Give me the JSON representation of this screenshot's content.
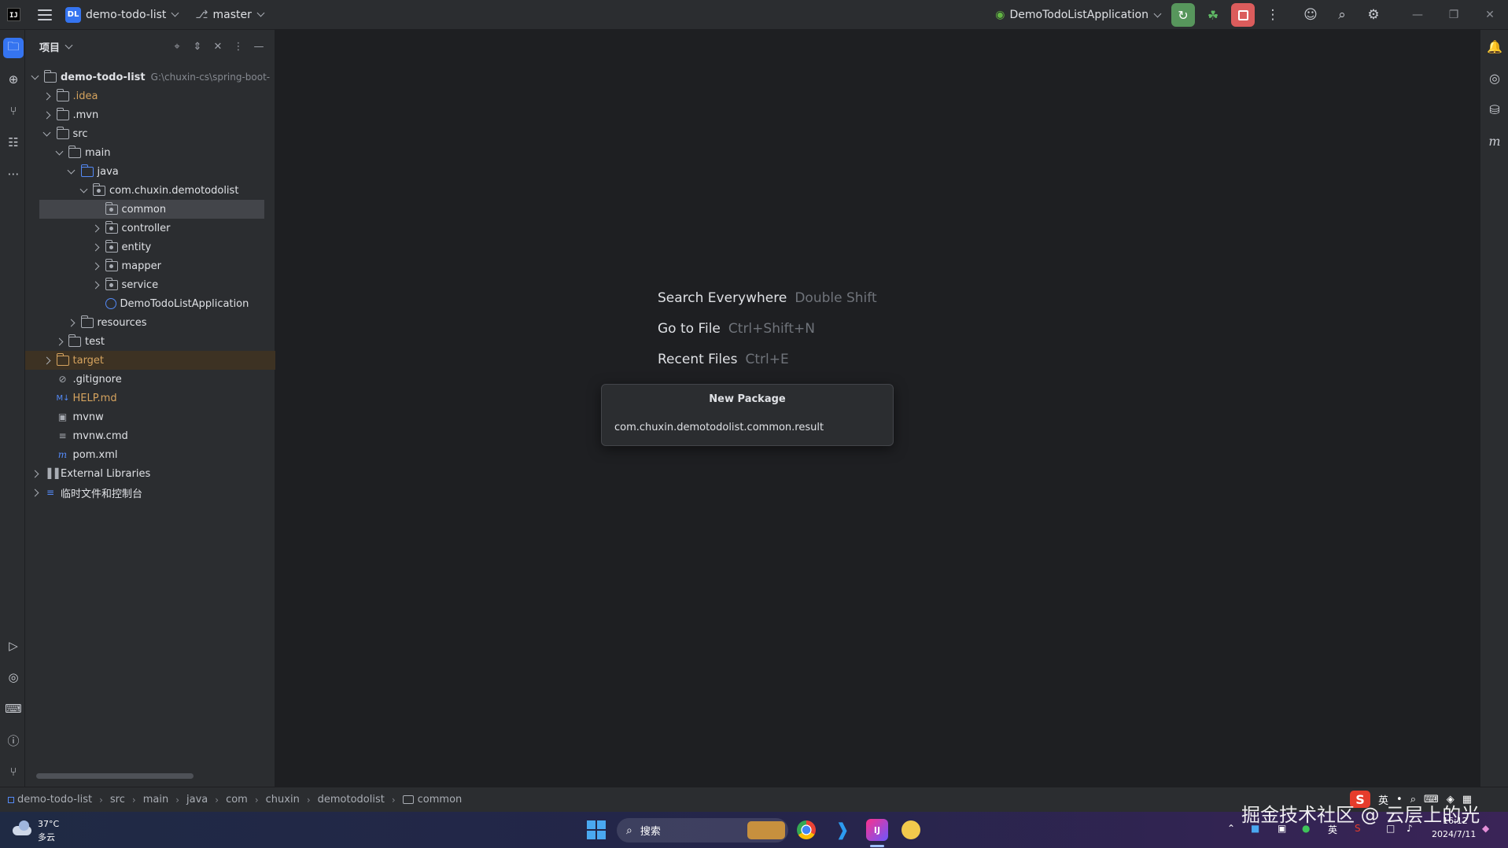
{
  "titlebar": {
    "app_logo": "IJ",
    "project_badge": "DL",
    "project_name": "demo-todo-list",
    "branch_name": "master",
    "run_config": "DemoTodoListApplication",
    "icons": [
      "hamburger-icon",
      "branch-icon",
      "rerun-icon",
      "debug-icon",
      "stop-icon",
      "more-icon",
      "add-user-icon",
      "search-icon",
      "settings-icon"
    ]
  },
  "project_panel": {
    "title": "项目",
    "tree": [
      {
        "label": "demo-todo-list",
        "path": "G:\\chuxin-cs\\spring-boot-",
        "depth": 0,
        "arrow": "d",
        "icon": "module",
        "bold": true
      },
      {
        "label": ".idea",
        "depth": 1,
        "arrow": "r",
        "icon": "folder",
        "color": "orange"
      },
      {
        "label": ".mvn",
        "depth": 1,
        "arrow": "r",
        "icon": "folder"
      },
      {
        "label": "src",
        "depth": 1,
        "arrow": "d",
        "icon": "folder"
      },
      {
        "label": "main",
        "depth": 2,
        "arrow": "d",
        "icon": "folder"
      },
      {
        "label": "java",
        "depth": 3,
        "arrow": "d",
        "icon": "folder-blue"
      },
      {
        "label": "com.chuxin.demotodolist",
        "depth": 4,
        "arrow": "d",
        "icon": "package"
      },
      {
        "label": "common",
        "depth": 5,
        "arrow": "none",
        "icon": "package",
        "selected": true
      },
      {
        "label": "controller",
        "depth": 5,
        "arrow": "r",
        "icon": "package"
      },
      {
        "label": "entity",
        "depth": 5,
        "arrow": "r",
        "icon": "package"
      },
      {
        "label": "mapper",
        "depth": 5,
        "arrow": "r",
        "icon": "package"
      },
      {
        "label": "service",
        "depth": 5,
        "arrow": "r",
        "icon": "package"
      },
      {
        "label": "DemoTodoListApplication",
        "depth": 5,
        "arrow": "none",
        "icon": "app"
      },
      {
        "label": "resources",
        "depth": 3,
        "arrow": "r",
        "icon": "folder"
      },
      {
        "label": "test",
        "depth": 2,
        "arrow": "r",
        "icon": "folder"
      },
      {
        "label": "target",
        "depth": 1,
        "arrow": "r",
        "icon": "folder-orange",
        "excluded": true,
        "color": "orange"
      },
      {
        "label": ".gitignore",
        "depth": 1,
        "arrow": "none",
        "icon": "ignore"
      },
      {
        "label": "HELP.md",
        "depth": 1,
        "arrow": "none",
        "icon": "markdown",
        "color": "orange"
      },
      {
        "label": "mvnw",
        "depth": 1,
        "arrow": "none",
        "icon": "terminal"
      },
      {
        "label": "mvnw.cmd",
        "depth": 1,
        "arrow": "none",
        "icon": "text"
      },
      {
        "label": "pom.xml",
        "depth": 1,
        "arrow": "none",
        "icon": "maven"
      },
      {
        "label": "External Libraries",
        "depth": 0,
        "arrow": "r",
        "icon": "library"
      },
      {
        "label": "临时文件和控制台",
        "depth": 0,
        "arrow": "r",
        "icon": "scratch"
      }
    ]
  },
  "editor_hints": [
    {
      "action": "Search Everywhere",
      "keys": "Double Shift"
    },
    {
      "action": "Go to File",
      "keys": "Ctrl+Shift+N"
    },
    {
      "action": "Recent Files",
      "keys": "Ctrl+E"
    }
  ],
  "new_package_dialog": {
    "title": "New Package",
    "value": "com.chuxin.demotodolist.common.result"
  },
  "breadcrumbs": [
    "demo-todo-list",
    "src",
    "main",
    "java",
    "com",
    "chuxin",
    "demotodolist",
    "common"
  ],
  "taskbar": {
    "weather_temp": "37°C",
    "weather_desc": "多云",
    "search_placeholder": "搜索",
    "ime_lang": "英",
    "clock_time": "16:12",
    "clock_date": "2024/7/11"
  },
  "watermark": "掘金技术社区 @ 云层上的光",
  "colors": {
    "accent": "#3574f0",
    "run_green": "#57965c",
    "stop_red": "#db5c5c",
    "excluded_orange": "#d5a35e"
  }
}
